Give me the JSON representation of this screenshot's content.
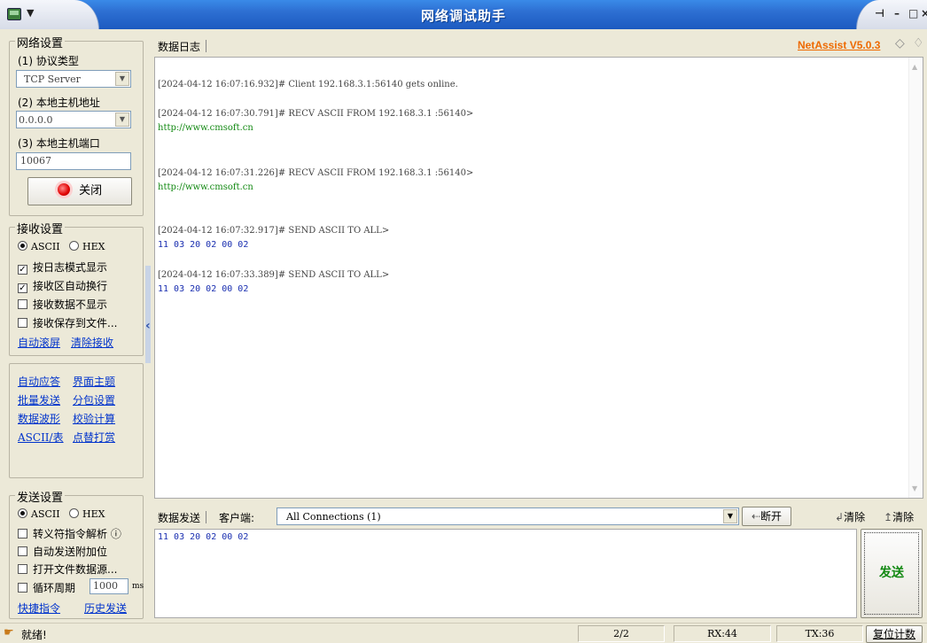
{
  "window": {
    "title": "网络调试助手"
  },
  "net_settings": {
    "group_title": "网络设置",
    "protocol_label": "(1) 协议类型",
    "protocol_value": "TCP Server",
    "host_label": "(2) 本地主机地址",
    "host_value": "0.0.0.0",
    "port_label": "(3) 本地主机端口",
    "port_value": "10067",
    "close_button": "关闭"
  },
  "recv_settings": {
    "group_title": "接收设置",
    "ascii": "ASCII",
    "hex": "HEX",
    "options": [
      "按日志模式显示",
      "接收区自动换行",
      "接收数据不显示",
      "接收保存到文件..."
    ],
    "checked": [
      true,
      true,
      false,
      false
    ],
    "link_autoscroll": "自动滚屏",
    "link_clear": "清除接收"
  },
  "tools": {
    "links": [
      "自动应答",
      "界面主题",
      "批量发送",
      "分包设置",
      "数据波形",
      "校验计算",
      "ASCII/表",
      "点替打赏"
    ]
  },
  "send_settings": {
    "group_title": "发送设置",
    "ascii": "ASCII",
    "hex": "HEX",
    "options": [
      "转义符指令解析 ⓘ",
      "自动发送附加位",
      "打开文件数据源...",
      "循环周期"
    ],
    "period_value": "1000",
    "period_unit": "ms",
    "link_shortcut": "快捷指令",
    "link_history": "历史发送"
  },
  "log": {
    "tab_label": "数据日志",
    "version": "NetAssist V5.0.3",
    "lines": [
      {
        "type": "hdr",
        "text": "[2024-04-12 16:07:16.932]# Client 192.168.3.1:56140 gets online."
      },
      {
        "type": "hdr",
        "text": "[2024-04-12 16:07:30.791]# RECV ASCII FROM 192.168.3.1 :56140>"
      },
      {
        "type": "recv",
        "text": "http://www.cmsoft.cn"
      },
      {
        "type": "hdr",
        "text": "[2024-04-12 16:07:31.226]# RECV ASCII FROM 192.168.3.1 :56140>"
      },
      {
        "type": "recv",
        "text": "http://www.cmsoft.cn"
      },
      {
        "type": "hdr",
        "text": "[2024-04-12 16:07:32.917]# SEND ASCII TO ALL>"
      },
      {
        "type": "send",
        "text": "11 03 20 02 00 02"
      },
      {
        "type": "hdr",
        "text": "[2024-04-12 16:07:33.389]# SEND ASCII TO ALL>"
      },
      {
        "type": "send",
        "text": "11 03 20 02 00 02"
      }
    ]
  },
  "send": {
    "tab_label": "数据发送",
    "client_label": "客户端:",
    "connection_value": "All Connections (1)",
    "disconnect_label": "断开",
    "clear_label_1": "清除",
    "clear_label_2": "清除",
    "send_text": "11 03 20 02 00 02",
    "send_button": "发送"
  },
  "status": {
    "ready": "就绪!",
    "page": "2/2",
    "rx": "RX:44",
    "tx": "TX:36",
    "reset": "复位计数"
  },
  "colors": {
    "titlebar": "#2d6fd2",
    "recv_text": "#118811",
    "send_text": "#1a2fb0",
    "version_link": "#ee6a00"
  }
}
